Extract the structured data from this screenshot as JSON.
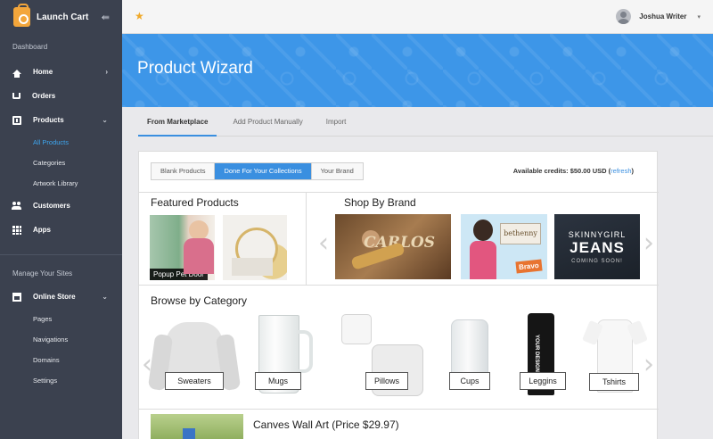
{
  "sidebar": {
    "brand": "Launch Cart",
    "section_dashboard": "Dashboard",
    "items": [
      {
        "label": "Home"
      },
      {
        "label": "Orders"
      },
      {
        "label": "Products"
      }
    ],
    "products_sub": [
      "All Products",
      "Categories",
      "Artwork Library"
    ],
    "items2": [
      {
        "label": "Customers"
      },
      {
        "label": "Apps"
      }
    ],
    "section_sites": "Manage Your Sites",
    "online_store": "Online Store",
    "store_sub": [
      "Pages",
      "Navigations",
      "Domains",
      "Settings"
    ]
  },
  "topbar": {
    "user_name": "Joshua Writer"
  },
  "hero": {
    "title": "Product Wizard"
  },
  "tabs": [
    "From Marketplace",
    "Add Product Manually",
    "Import"
  ],
  "segments": [
    "Blank Products",
    "Done For Your Collections",
    "Your Brand"
  ],
  "credits": {
    "label": "Available credits: $50.00 USD (",
    "link": "refresh",
    "suffix": ")"
  },
  "featured": {
    "title": "Featured Products",
    "items": [
      "Popup Pet Door"
    ]
  },
  "brands": {
    "title": "Shop By Brand",
    "carlos": "CARLOS",
    "bethenny": "bethenny",
    "bravo": "Bravo",
    "skinny_1": "SKINNYGIRL",
    "skinny_2": "JEANS",
    "skinny_3": "COMING SOON!"
  },
  "categories": {
    "title": "Browse by Category",
    "items": [
      "Sweaters",
      "Mugs",
      "Pillows",
      "Cups",
      "Leggins",
      "Tshirts"
    ]
  },
  "wall_art": {
    "title": "Canves Wall Art (Price $29.97)"
  },
  "colors": {
    "sidebar": "#3b414f",
    "accent": "#3a8fe0",
    "hero": "#3d96e8",
    "active_link": "#3ea6ef"
  }
}
